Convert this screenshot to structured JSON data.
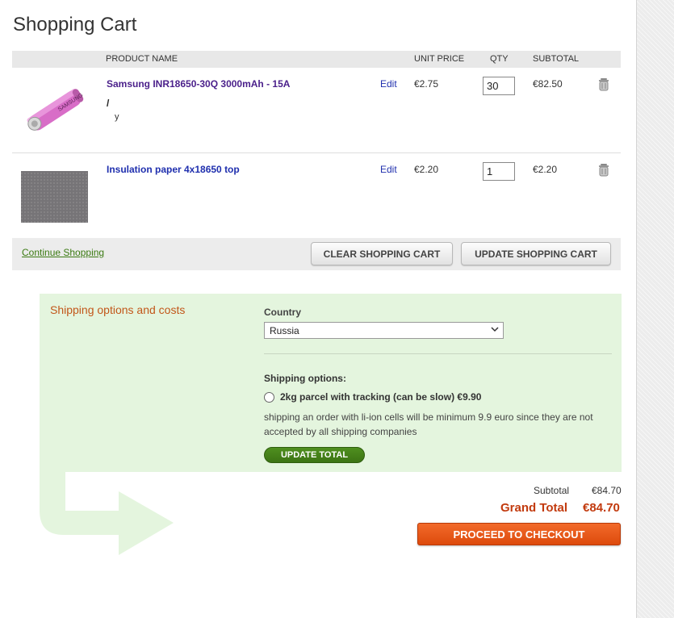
{
  "page": {
    "title": "Shopping Cart"
  },
  "cart": {
    "columns": {
      "product_name": "PRODUCT NAME",
      "unit_price": "UNIT PRICE",
      "qty": "QTY",
      "subtotal": "SUBTOTAL"
    },
    "items": [
      {
        "name": "Samsung INR18650-30Q 3000mAh - 15A",
        "option_label": "/",
        "option_value": "y",
        "edit": "Edit",
        "unit_price": "€2.75",
        "qty": "30",
        "subtotal": "€82.50",
        "thumb_icon": "pink-18650-battery-image",
        "delete_icon": "trash-icon"
      },
      {
        "name": "Insulation paper 4x18650 top",
        "edit": "Edit",
        "unit_price": "€2.20",
        "qty": "1",
        "subtotal": "€2.20",
        "thumb_icon": "gray-insulation-paper-image",
        "delete_icon": "trash-icon"
      }
    ],
    "actions": {
      "continue": "Continue Shopping",
      "clear": "Clear Shopping Cart",
      "update": "Update Shopping Cart"
    }
  },
  "shipping": {
    "title": "Shipping options and costs",
    "country_label": "Country",
    "country_value": "Russia",
    "options_label": "Shipping options:",
    "option_text": "2kg parcel with tracking (can be slow) €9.90",
    "note": "shipping an order with li-ion cells will be minimum 9.9 euro since they are not accepted by all shipping companies",
    "update_total": "Update Total"
  },
  "totals": {
    "subtotal_label": "Subtotal",
    "subtotal_value": "€84.70",
    "grand_label": "Grand Total",
    "grand_value": "€84.70",
    "checkout": "Proceed to Checkout"
  },
  "colors": {
    "accent_orange": "#e85a1b",
    "shipping_bg": "#e4f5de",
    "grand_total": "#c23a0e",
    "green_button": "#3c7414"
  }
}
